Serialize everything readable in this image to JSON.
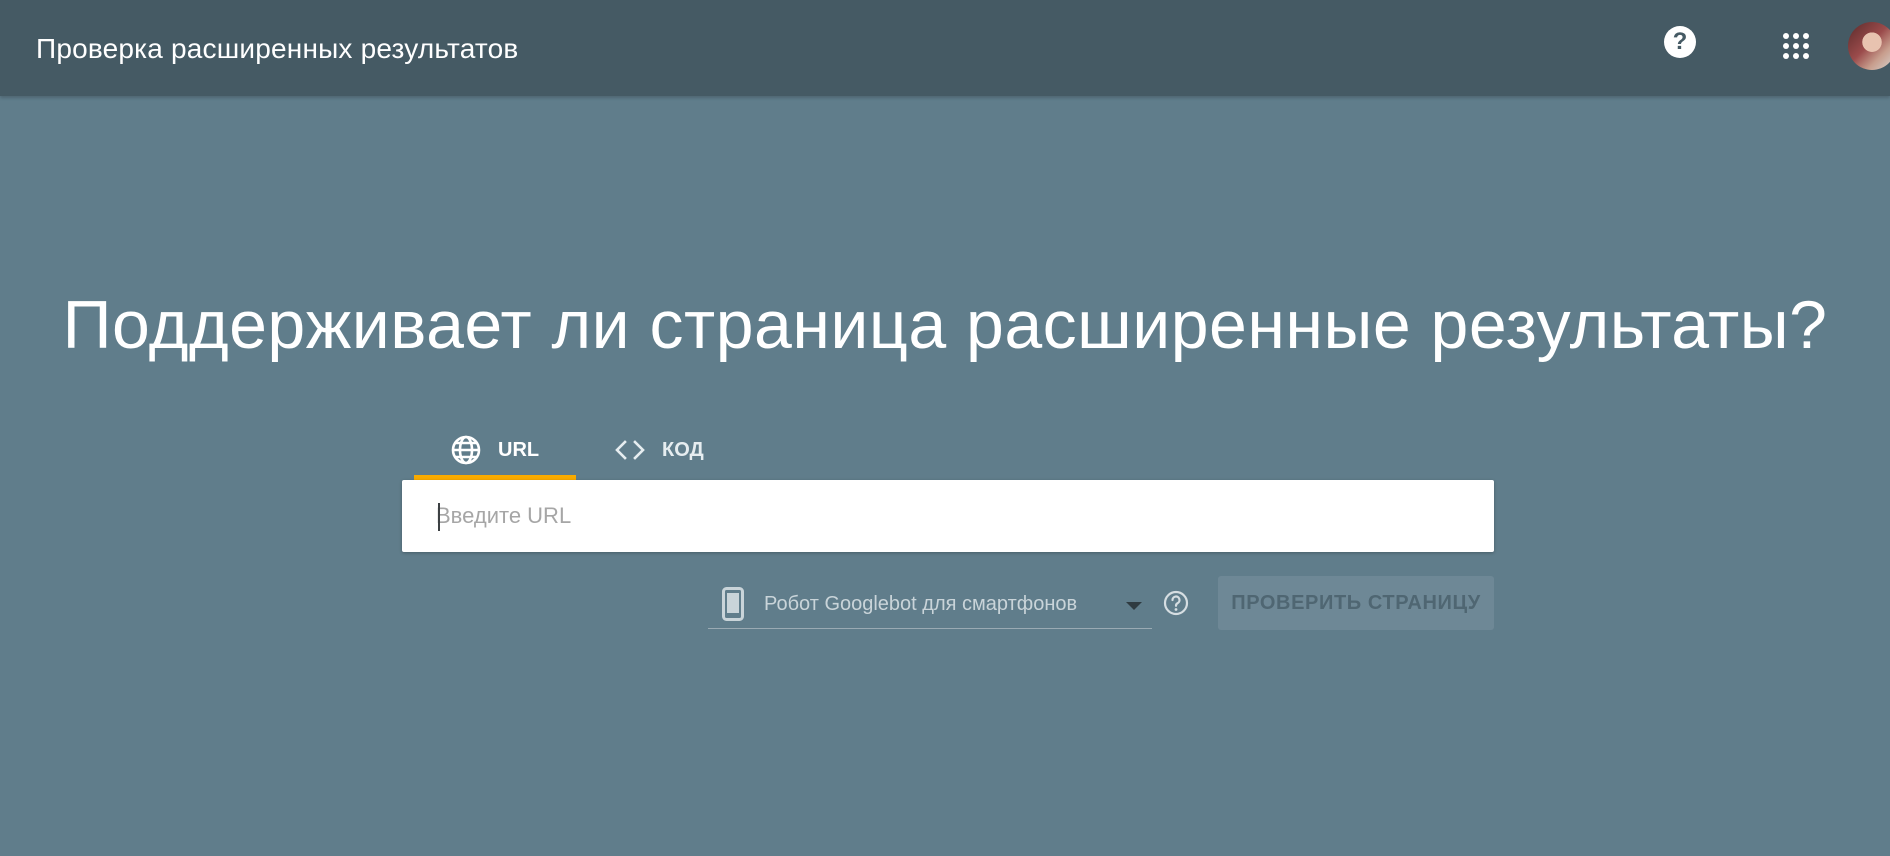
{
  "header": {
    "title": "Проверка расширенных результатов",
    "help_icon": "help-circle-icon",
    "apps_icon": "apps-grid-icon",
    "avatar": "user-avatar"
  },
  "main": {
    "headline": "Поддерживает ли страница расширенные результаты?",
    "tabs": [
      {
        "label": "URL",
        "icon": "globe-icon",
        "active": true
      },
      {
        "label": "КОД",
        "icon": "code-icon",
        "active": false
      }
    ],
    "url_input": {
      "placeholder": "Введите URL",
      "value": ""
    },
    "crawler_select": {
      "icon": "smartphone-icon",
      "selected": "Робот Googlebot для смартфонов"
    },
    "check_button": {
      "label": "ПРОВЕРИТЬ СТРАНИЦУ",
      "enabled": false
    }
  },
  "colors": {
    "background": "#607d8b",
    "topbar": "#455a64",
    "tab_indicator": "#f9ab00"
  }
}
